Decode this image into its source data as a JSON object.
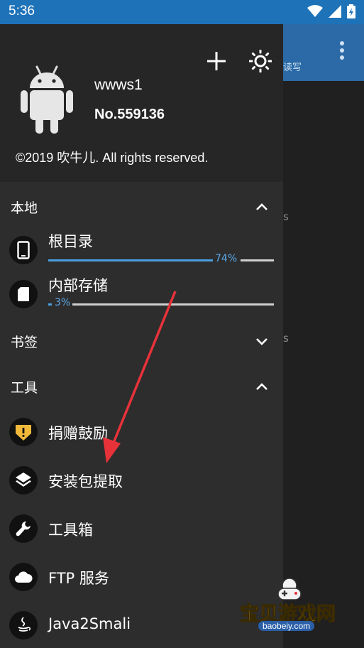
{
  "status_bar": {
    "time": "5:36"
  },
  "header": {
    "username": "wwws1",
    "user_number": "No.559136",
    "copyright": "©2019 吹牛儿. All rights reserved."
  },
  "background": {
    "tab_fragment": "读写",
    "text_a": "s",
    "text_b": "s"
  },
  "sections": {
    "local": "本地",
    "bookmarks": "书签",
    "tools": "工具"
  },
  "storage": [
    {
      "name": "根目录",
      "percent_label": "74%",
      "percent": 74
    },
    {
      "name": "内部存储",
      "percent_label": "3%",
      "percent": 3
    }
  ],
  "tools": [
    {
      "label": "捐赠鼓励",
      "icon": "donate-icon"
    },
    {
      "label": "安装包提取",
      "icon": "layers-icon"
    },
    {
      "label": "工具箱",
      "icon": "wrench-icon"
    },
    {
      "label": "FTP 服务",
      "icon": "cloud-icon"
    },
    {
      "label": "Java2Smali",
      "icon": "java-icon"
    }
  ],
  "watermark": {
    "title": "宝贝游戏网",
    "url": "baobeiy.com"
  },
  "colors": {
    "accent": "#4a9fe0",
    "status_bar": "#1e72b8",
    "drawer": "#2d2d2d"
  }
}
